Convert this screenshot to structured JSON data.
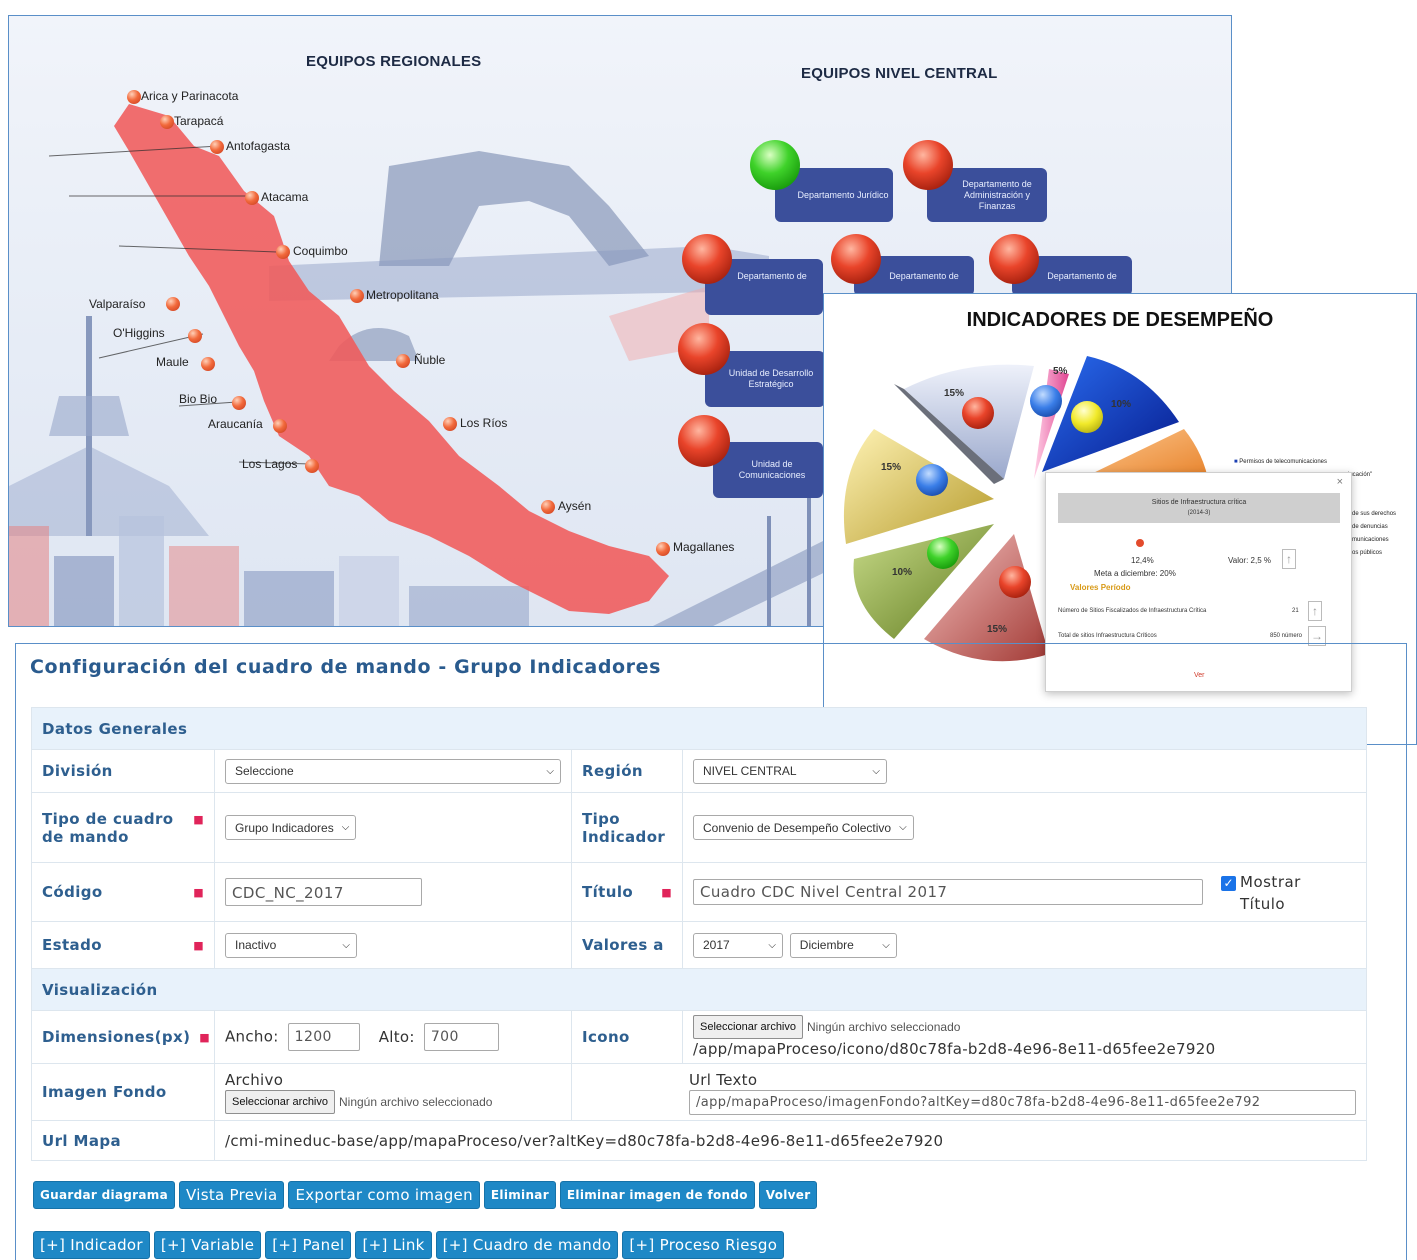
{
  "map": {
    "heading_regional": "EQUIPOS REGIONALES",
    "heading_central": "EQUIPOS NIVEL CENTRAL",
    "regions": [
      "Arica y Parinacota",
      "Tarapacá",
      "Antofagasta",
      "Atacama",
      "Coquimbo",
      "Metropolitana",
      "Valparaíso",
      "O'Higgins",
      "Maule",
      "Ñuble",
      "Bio Bio",
      "Araucanía",
      "Los Ríos",
      "Los Lagos",
      "Aysén",
      "Magallanes"
    ],
    "departments": [
      "Departamento Jurídico",
      "Departamento de Administración y Finanzas",
      "Departamento de",
      "Departamento de",
      "Departamento de",
      "Unidad de Desarrollo Estratégico",
      "Unidad de Comunicaciones"
    ],
    "dept_status": [
      "green",
      "red",
      "red",
      "red",
      "red",
      "red",
      "red"
    ]
  },
  "indicators": {
    "title": "INDICADORES DE DESEMPEÑO",
    "pie_labels": [
      "15%",
      "5%",
      "10%",
      "15%",
      "10%",
      "15%"
    ],
    "legend": [
      "Permisos de telecomunicaciones",
      "ducación\"",
      "de sus derechos",
      "de denuncias",
      "municaciones",
      "os públicos"
    ],
    "popup": {
      "close": "×",
      "header": "Sitios de Infraestructura crítica",
      "header_sub": "(2014-3)",
      "percent": "12,4%",
      "valor": "Valor: 2,5 %",
      "meta": "Meta a diciembre: 20%",
      "valores_periodo": "Valores Período",
      "row1_label": "Número de Sitios Fiscalizados de Infraestructura Crítica",
      "row1_value": "21",
      "row2_label": "Total de sitios Infraestructura Críticos",
      "row2_value": "850 número",
      "ver": "Ver"
    }
  },
  "config": {
    "title": "Configuración del cuadro de mando - Grupo Indicadores",
    "section_general": "Datos Generales",
    "division_label": "División",
    "division_value": "Seleccione",
    "region_label": "Región",
    "region_value": "NIVEL CENTRAL",
    "tipo_cuadro_label": "Tipo de cuadro de mando",
    "tipo_cuadro_value": "Grupo Indicadores",
    "tipo_indicador_label": "Tipo Indicador",
    "tipo_indicador_value": "Convenio de Desempeño Colectivo",
    "codigo_label": "Código",
    "codigo_value": "CDC_NC_2017",
    "titulo_label": "Título",
    "titulo_value": "Cuadro CDC Nivel Central 2017",
    "mostrar_label": "Mostrar Título",
    "mostrar_checked": true,
    "estado_label": "Estado",
    "estado_value": "Inactivo",
    "valores_label": "Valores a",
    "valores_year": "2017",
    "valores_month": "Diciembre",
    "section_visual": "Visualización",
    "dimensiones_label": "Dimensiones(px)",
    "ancho_label": "Ancho:",
    "ancho_value": "1200",
    "alto_label": "Alto:",
    "alto_value": "700",
    "icono_label": "Icono",
    "file_button": "Seleccionar archivo",
    "file_none": "Ningún archivo seleccionado",
    "icono_path": "/app/mapaProceso/icono/d80c78fa-b2d8-4e96-8e11-d65fee2e7920",
    "imagen_label": "Imagen Fondo",
    "archivo_label": "Archivo",
    "url_texto_label": "Url Texto",
    "url_texto_value": "/app/mapaProceso/imagenFondo?altKey=d80c78fa-b2d8-4e96-8e11-d65fee2e792",
    "url_mapa_label": "Url Mapa",
    "url_mapa_value": "/cmi-mineduc-base/app/mapaProceso/ver?altKey=d80c78fa-b2d8-4e96-8e11-d65fee2e7920"
  },
  "actions": {
    "guardar": "Guardar diagrama",
    "vista_previa": "Vista Previa",
    "exportar": "Exportar como imagen",
    "eliminar": "Eliminar",
    "eliminar_fondo": "Eliminar imagen de fondo",
    "volver": "Volver",
    "add_indicador": "[+] Indicador",
    "add_variable": "[+] Variable",
    "add_panel": "[+] Panel",
    "add_link": "[+] Link",
    "add_cuadro": "[+] Cuadro de mando",
    "add_riesgo": "[+] Proceso Riesgo"
  },
  "colors": {
    "accent": "#1e88c6",
    "title": "#2a5b8e",
    "required": "#e0245a",
    "map_region": "#f05a5a",
    "dept_box": "#3b4f9b"
  }
}
